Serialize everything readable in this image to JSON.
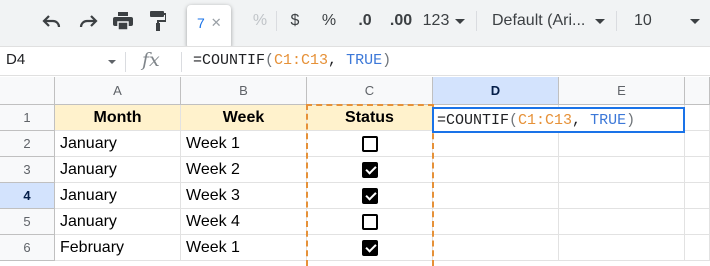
{
  "toolbar": {
    "undo_icon": "undo-icon",
    "redo_icon": "redo-icon",
    "print_icon": "print-icon",
    "paint_format_icon": "paint-format-icon",
    "tooltip_count": "7",
    "tooltip_close": "✕",
    "percent_hidden": "%",
    "currency": "$",
    "percent": "%",
    "decrease_decimal": ".0",
    "increase_decimal": ".00",
    "more_formats": "123",
    "font": "Default (Ari...",
    "font_size": "10"
  },
  "formula_bar": {
    "name_box": "D4",
    "fx": "fx",
    "formula_prefix": "=COUNTIF",
    "open_paren": "(",
    "range": "C1:C13",
    "comma": ", ",
    "bool": "TRUE",
    "close_paren": ")"
  },
  "columns": [
    "A",
    "B",
    "C",
    "D",
    "E"
  ],
  "rows": [
    "1",
    "2",
    "3",
    "4",
    "5",
    "6"
  ],
  "headers": {
    "month": "Month",
    "week": "Week",
    "status": "Status"
  },
  "data": [
    {
      "month": "January",
      "week": "Week 1",
      "status": false
    },
    {
      "month": "January",
      "week": "Week 2",
      "status": true
    },
    {
      "month": "January",
      "week": "Week 3",
      "status": true
    },
    {
      "month": "January",
      "week": "Week 4",
      "status": false
    },
    {
      "month": "February",
      "week": "Week 1",
      "status": true
    }
  ],
  "editor": {
    "formula_prefix": "=COUNTIF",
    "open_paren": "(",
    "range": "C1:C13",
    "comma": ", ",
    "bool": "TRUE",
    "close_paren": ")"
  },
  "colors": {
    "header_fill": "#fff2cc",
    "range_color": "#e69138",
    "bool_color": "#3c78d8",
    "selection": "#1a73e8"
  }
}
